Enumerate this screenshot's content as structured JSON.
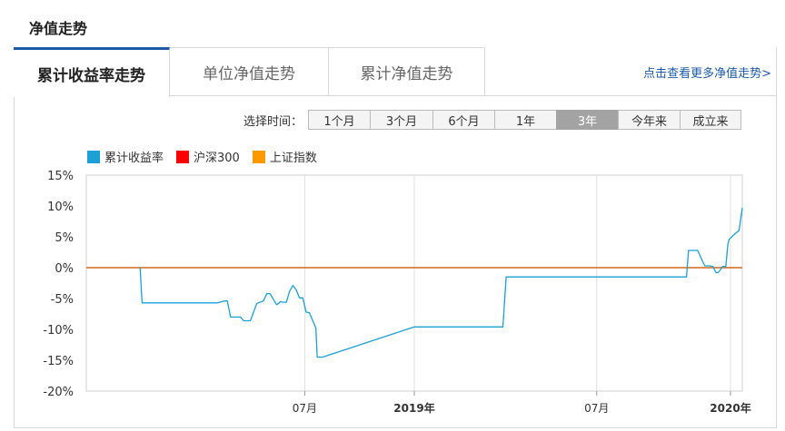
{
  "section_title": "净值走势",
  "tabs": [
    {
      "label": "累计收益率走势",
      "active": true
    },
    {
      "label": "单位净值走势",
      "active": false
    },
    {
      "label": "累计净值走势",
      "active": false
    }
  ],
  "more_link": "点击查看更多净值走势>",
  "range": {
    "label": "选择时间：",
    "options": [
      "1个月",
      "3个月",
      "6个月",
      "1年",
      "3年",
      "今年来",
      "成立来"
    ],
    "selected": "3年"
  },
  "colors": {
    "fund": "#1ba0d7",
    "hs300": "#ff0000",
    "sz": "#ff9900",
    "zero_line": "#d2691e"
  },
  "chart_data": {
    "type": "line",
    "legend": [
      "累计收益率",
      "沪深300",
      "上证指数"
    ],
    "x_ticks": [
      {
        "label": "07月",
        "pos": 0.333,
        "bold": false
      },
      {
        "label": "2019年",
        "pos": 0.5,
        "bold": true
      },
      {
        "label": "07月",
        "pos": 0.778,
        "bold": false
      },
      {
        "label": "2020年",
        "pos": 0.982,
        "bold": true
      }
    ],
    "ylim": [
      -20,
      15
    ],
    "y_ticks": [
      15,
      10,
      5,
      0,
      -5,
      -10,
      -15,
      -20
    ],
    "y_tick_labels": [
      "15%",
      "10%",
      "5%",
      "0%",
      "-5%",
      "-10%",
      "-15%",
      "-20%"
    ],
    "series": [
      {
        "name": "累计收益率",
        "x": [
          0.082,
          0.085,
          0.09,
          0.15,
          0.2,
          0.21,
          0.215,
          0.22,
          0.235,
          0.24,
          0.25,
          0.26,
          0.27,
          0.275,
          0.28,
          0.29,
          0.293,
          0.296,
          0.3,
          0.305,
          0.31,
          0.315,
          0.32,
          0.325,
          0.33,
          0.335,
          0.34,
          0.35,
          0.352,
          0.36,
          0.5,
          0.63,
          0.635,
          0.64,
          0.7,
          0.8,
          0.9,
          0.915,
          0.918,
          0.93,
          0.932,
          0.94,
          0.943,
          0.95,
          0.955,
          0.96,
          0.963,
          0.967,
          0.97,
          0.975,
          0.978,
          0.98,
          0.99,
          0.995,
          1.0
        ],
        "y": [
          0,
          -5.7,
          -5.7,
          -5.7,
          -5.7,
          -5.4,
          -5.4,
          -8.0,
          -8.0,
          -8.6,
          -8.6,
          -5.8,
          -5.4,
          -4.2,
          -4.2,
          -6.0,
          -5.8,
          -5.5,
          -5.6,
          -5.6,
          -3.8,
          -2.9,
          -3.6,
          -4.9,
          -4.9,
          -7.2,
          -7.3,
          -9.8,
          -14.5,
          -14.5,
          -9.6,
          -9.6,
          -9.6,
          -1.5,
          -1.5,
          -1.5,
          -1.5,
          -1.5,
          2.8,
          2.8,
          2.8,
          0.9,
          0.3,
          0.3,
          0.2,
          -0.8,
          -0.8,
          -0.3,
          0.2,
          0.2,
          3.8,
          4.6,
          5.6,
          6.0,
          9.7
        ]
      },
      {
        "name": "沪深300",
        "x": [
          0.0,
          1.0
        ],
        "y": [
          0,
          0
        ]
      }
    ]
  }
}
